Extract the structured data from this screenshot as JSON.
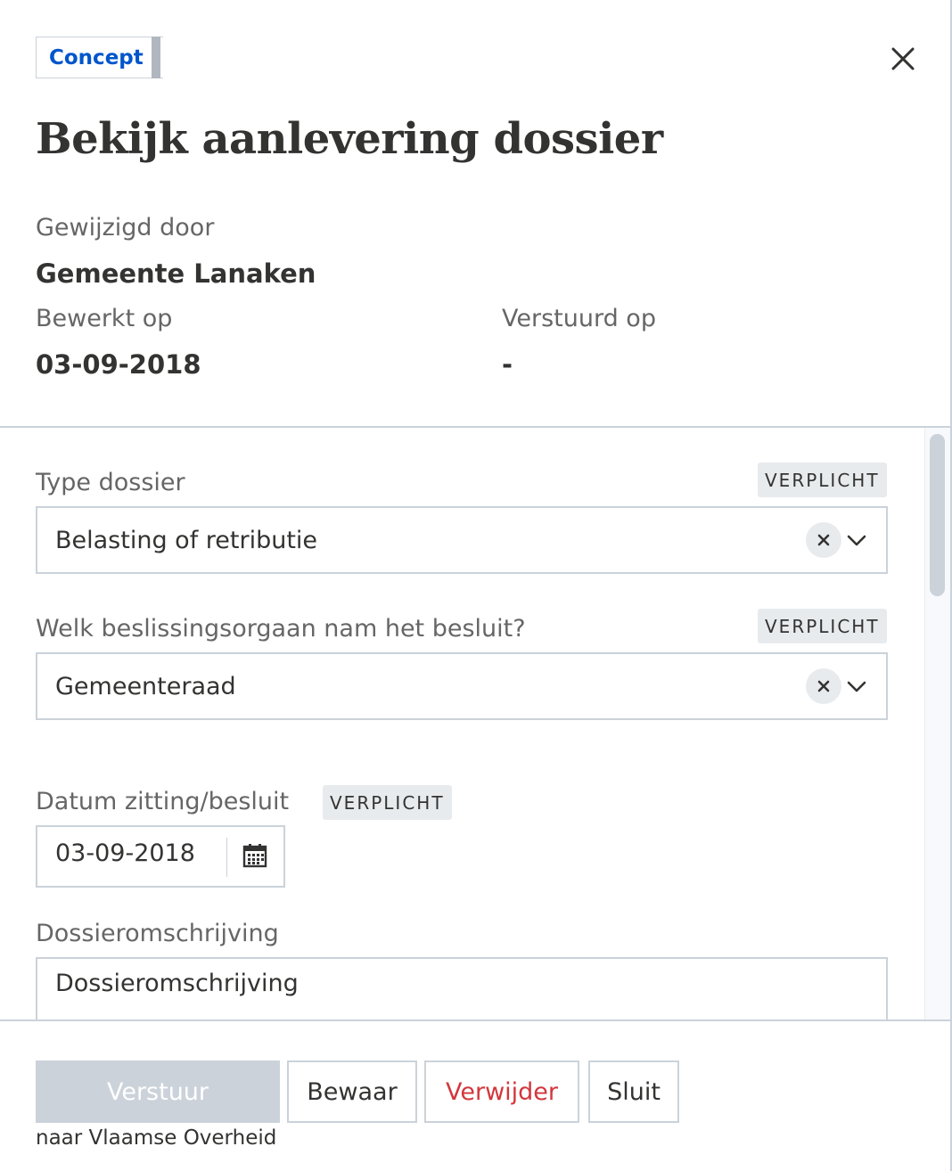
{
  "header": {
    "status": "Concept",
    "title": "Bekijk aanlevering dossier",
    "close_icon": "close-icon"
  },
  "meta": {
    "modified_by_label": "Gewijzigd door",
    "modified_by_value": "Gemeente Lanaken",
    "edited_on_label": "Bewerkt op",
    "edited_on_value": "03-09-2018",
    "sent_on_label": "Verstuurd op",
    "sent_on_value": "-"
  },
  "form": {
    "required_tag": "VERPLICHT",
    "type_dossier": {
      "label": "Type dossier",
      "value": "Belasting of retributie"
    },
    "beslissingsorgaan": {
      "label": "Welk beslissingsorgaan nam het besluit?",
      "value": "Gemeenteraad"
    },
    "datum": {
      "label": "Datum zitting/besluit",
      "value": "03-09-2018",
      "icon": "calendar-icon"
    },
    "omschrijving": {
      "label": "Dossieromschrijving",
      "value": "Dossieromschrijving"
    }
  },
  "footer": {
    "send_label": "Verstuur",
    "send_note": "naar Vlaamse Overheid",
    "save_label": "Bewaar",
    "delete_label": "Verwijder",
    "close_label": "Sluit"
  },
  "colors": {
    "accent_blue": "#0055cc",
    "danger_red": "#d2373c",
    "border_gray": "#cbd2da",
    "tag_bg": "#e8ebee"
  }
}
